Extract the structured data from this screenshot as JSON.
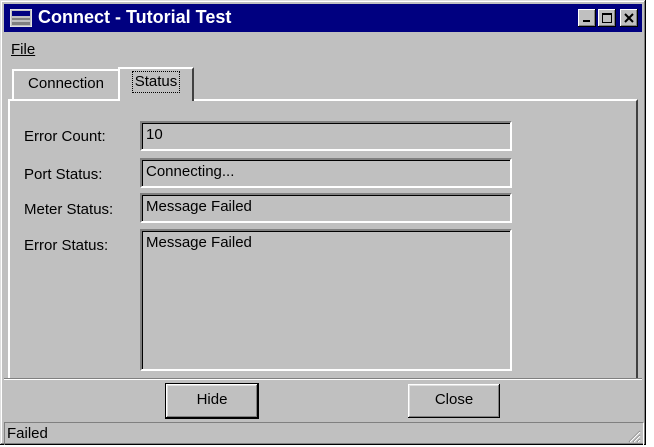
{
  "window": {
    "title": "Connect - Tutorial Test"
  },
  "menu": {
    "file_label": "File"
  },
  "tabs": [
    {
      "label": "Connection"
    },
    {
      "label": "Status"
    }
  ],
  "fields": [
    {
      "label": "Error Count:",
      "value": "10"
    },
    {
      "label": "Port Status:",
      "value": "Connecting..."
    },
    {
      "label": "Meter Status:",
      "value": "Message Failed"
    },
    {
      "label": "Error Status:",
      "value": "Message Failed"
    }
  ],
  "buttons": {
    "hide_label": "Hide",
    "close_label": "Close"
  },
  "statusbar": {
    "text": "Failed"
  },
  "icons": {
    "app": "connect-app-icon",
    "minimize": "minimize-icon",
    "maximize": "maximize-icon",
    "close": "close-icon",
    "grip": "resize-grip-icon"
  },
  "colors": {
    "titlebar": "#000080",
    "face": "#c0c0c0"
  }
}
